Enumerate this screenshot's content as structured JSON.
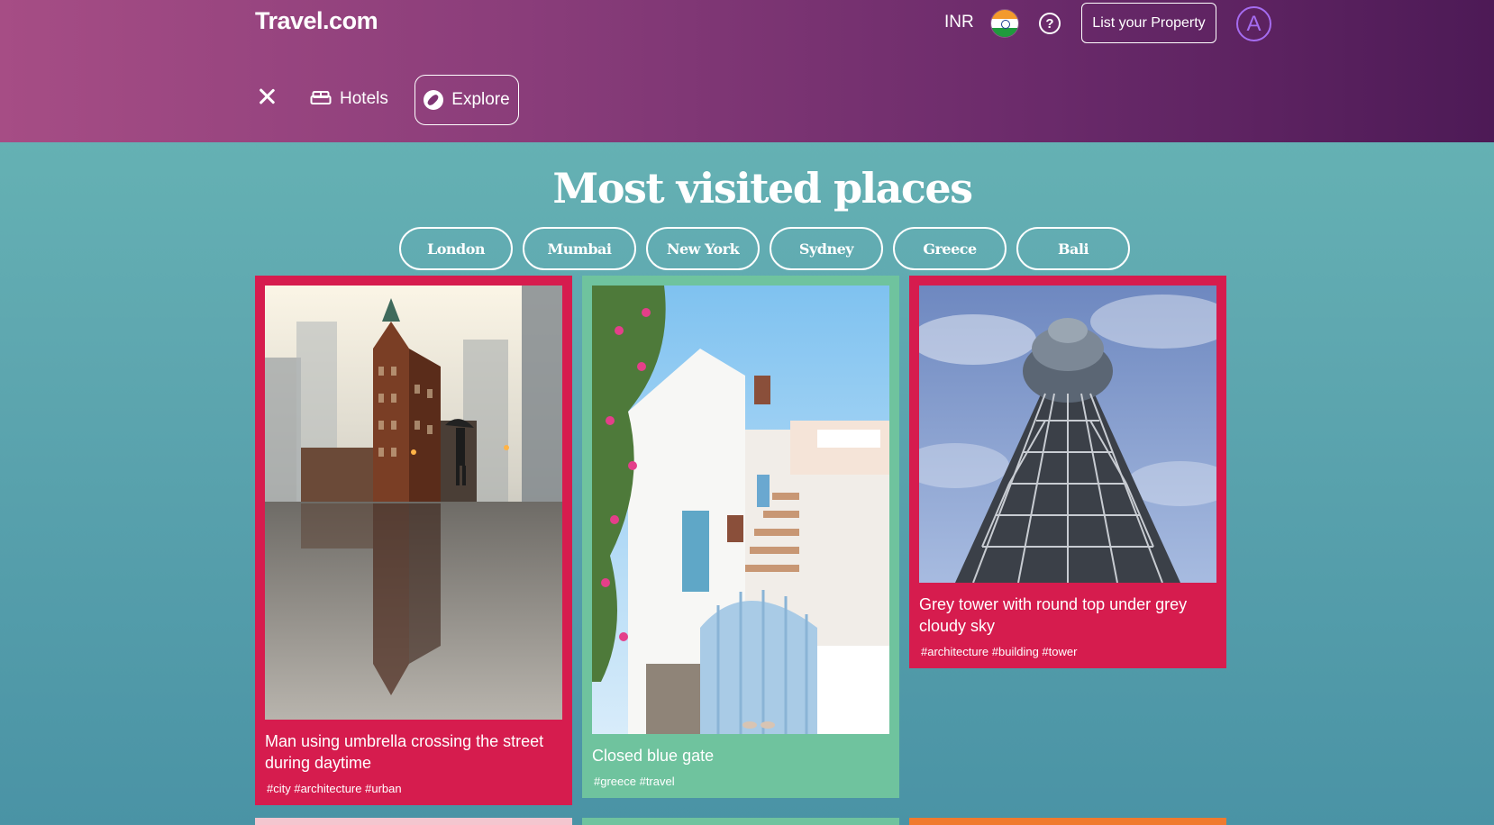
{
  "header": {
    "logo": "Travel.com",
    "currency": "INR",
    "list_property_label": "List your Property",
    "avatar_letter": "A",
    "help_symbol": "?"
  },
  "nav": {
    "hotels_label": "Hotels",
    "explore_label": "Explore"
  },
  "main": {
    "title": "Most visited places",
    "chips": [
      "London",
      "Mumbai",
      "New York",
      "Sydney",
      "Greece",
      "Bali"
    ]
  },
  "cards": [
    {
      "caption": "Man using umbrella crossing the street during daytime",
      "tags": "#city #architecture #urban",
      "color": "#d61c4e"
    },
    {
      "caption": "Closed blue gate",
      "tags": "#greece #travel",
      "color": "#6fc39e"
    },
    {
      "caption": "Grey tower with round top under grey cloudy sky",
      "tags": "#architecture #building #tower",
      "color": "#d61c4e"
    }
  ],
  "peek_colors": [
    "#f4c6cf",
    "#6fc39e",
    "#f07a2e"
  ],
  "icons": {
    "close": "close-icon",
    "hotels": "bed-icon",
    "explore": "compass-icon",
    "help": "help-icon",
    "flag": "india-flag-icon"
  }
}
